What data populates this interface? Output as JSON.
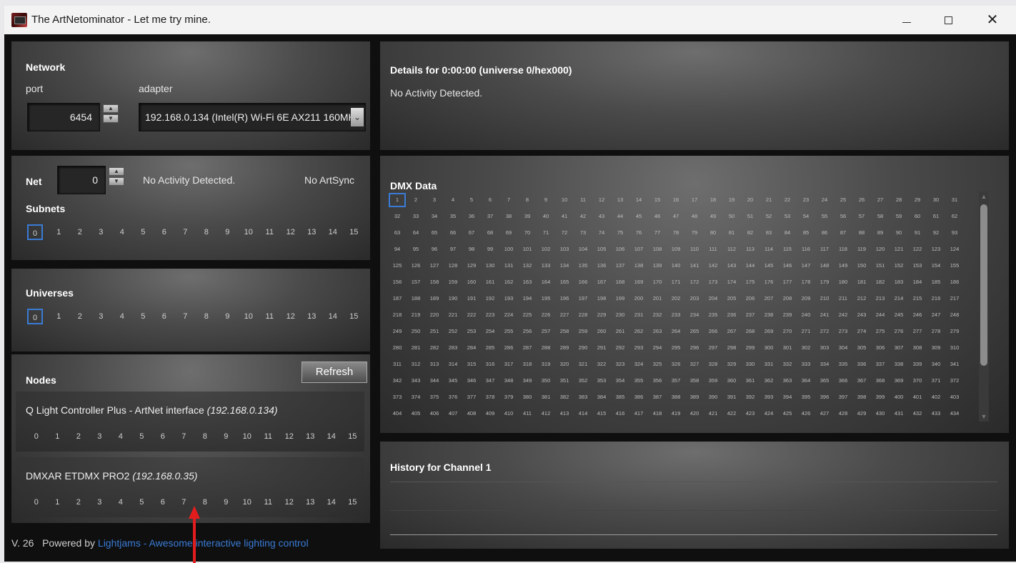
{
  "window": {
    "title": "The ArtNetominator - Let me try mine."
  },
  "network": {
    "heading": "Network",
    "port_label": "port",
    "adapter_label": "adapter",
    "port_value": "6454",
    "adapter_value": "192.168.0.134 (Intel(R) Wi-Fi 6E AX211 160MHz)"
  },
  "net": {
    "label": "Net",
    "value": "0",
    "activity": "No Activity Detected.",
    "sync": "No ArtSync"
  },
  "subnets": {
    "heading": "Subnets",
    "items": [
      "0",
      "1",
      "2",
      "3",
      "4",
      "5",
      "6",
      "7",
      "8",
      "9",
      "10",
      "11",
      "12",
      "13",
      "14",
      "15"
    ],
    "selected": "0"
  },
  "universes": {
    "heading": "Universes",
    "items": [
      "0",
      "1",
      "2",
      "3",
      "4",
      "5",
      "6",
      "7",
      "8",
      "9",
      "10",
      "11",
      "12",
      "13",
      "14",
      "15"
    ],
    "selected": "0"
  },
  "nodes": {
    "heading": "Nodes",
    "refresh_label": "Refresh",
    "list": [
      {
        "name": "Q Light Controller Plus - ArtNet interface",
        "ip": "(192.168.0.134)",
        "universes": [
          "0",
          "1",
          "2",
          "3",
          "4",
          "5",
          "6",
          "7",
          "8",
          "9",
          "10",
          "11",
          "12",
          "13",
          "14",
          "15"
        ]
      },
      {
        "name": "DMXAR ETDMX PRO2",
        "ip": "(192.168.0.35)",
        "universes": [
          "0",
          "1",
          "2",
          "3",
          "4",
          "5",
          "6",
          "7",
          "8",
          "9",
          "10",
          "11",
          "12",
          "13",
          "14",
          "15"
        ]
      }
    ]
  },
  "details": {
    "heading": "Details for 0:00:00 (universe 0/hex000)",
    "status": "No Activity Detected."
  },
  "dmx": {
    "heading": "DMX Data",
    "channel_count": 434,
    "columns": 31,
    "selected": 1
  },
  "history": {
    "heading": "History for Channel 1"
  },
  "footer": {
    "version": "V. 26",
    "powered_by": "Powered by",
    "link_text": "Lightjams - Awesome interactive lighting control"
  },
  "colors": {
    "accent": "#3a7bd5",
    "annotation": "#e31d1d"
  }
}
